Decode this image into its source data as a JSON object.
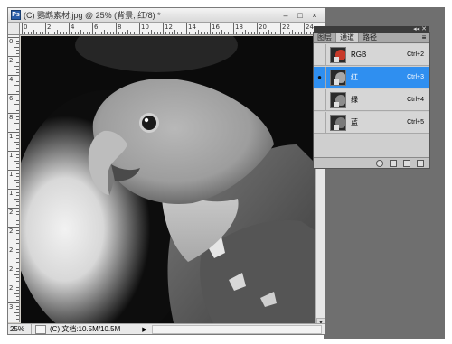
{
  "document": {
    "title": "(C) 鹦鹉素材.jpg @ 25% (背景, 红/8) *",
    "app_icon": "Ps",
    "minimize": "–",
    "restore": "□",
    "close": "×"
  },
  "rulers": {
    "top_labels": [
      "0",
      "2",
      "4",
      "6",
      "8",
      "10",
      "12",
      "14",
      "16",
      "18",
      "20",
      "22",
      "24"
    ],
    "left_labels": [
      "0",
      "2",
      "4",
      "6",
      "8",
      "1",
      "1",
      "1",
      "1",
      "2",
      "2",
      "2",
      "2",
      "2",
      "3"
    ]
  },
  "status": {
    "zoom": "25%",
    "doc_info": "(C) 文档:10.5M/10.5M",
    "arrow": "▶"
  },
  "panel": {
    "collapse": "◂◂ ✕",
    "tabs": [
      {
        "label": "图层",
        "active": false
      },
      {
        "label": "通道",
        "active": true
      },
      {
        "label": "路径",
        "active": false
      }
    ],
    "menu_icon": "≡",
    "channels": [
      {
        "name": "RGB",
        "shortcut": "Ctrl+2",
        "visible": false,
        "selected": false,
        "thumb": "color"
      },
      {
        "name": "红",
        "shortcut": "Ctrl+3",
        "visible": true,
        "selected": true,
        "thumb": "gray"
      },
      {
        "name": "绿",
        "shortcut": "Ctrl+4",
        "visible": false,
        "selected": false,
        "thumb": "gray"
      },
      {
        "name": "蓝",
        "shortcut": "Ctrl+5",
        "visible": false,
        "selected": false,
        "thumb": "gray"
      }
    ],
    "eye_icon": "●",
    "bottom_icons": [
      "load-selection-icon",
      "save-selection-icon",
      "new-channel-icon",
      "delete-channel-icon"
    ]
  },
  "colors": {
    "selected_row": "#2f8ff0",
    "workspace": "#6f6f6f"
  }
}
